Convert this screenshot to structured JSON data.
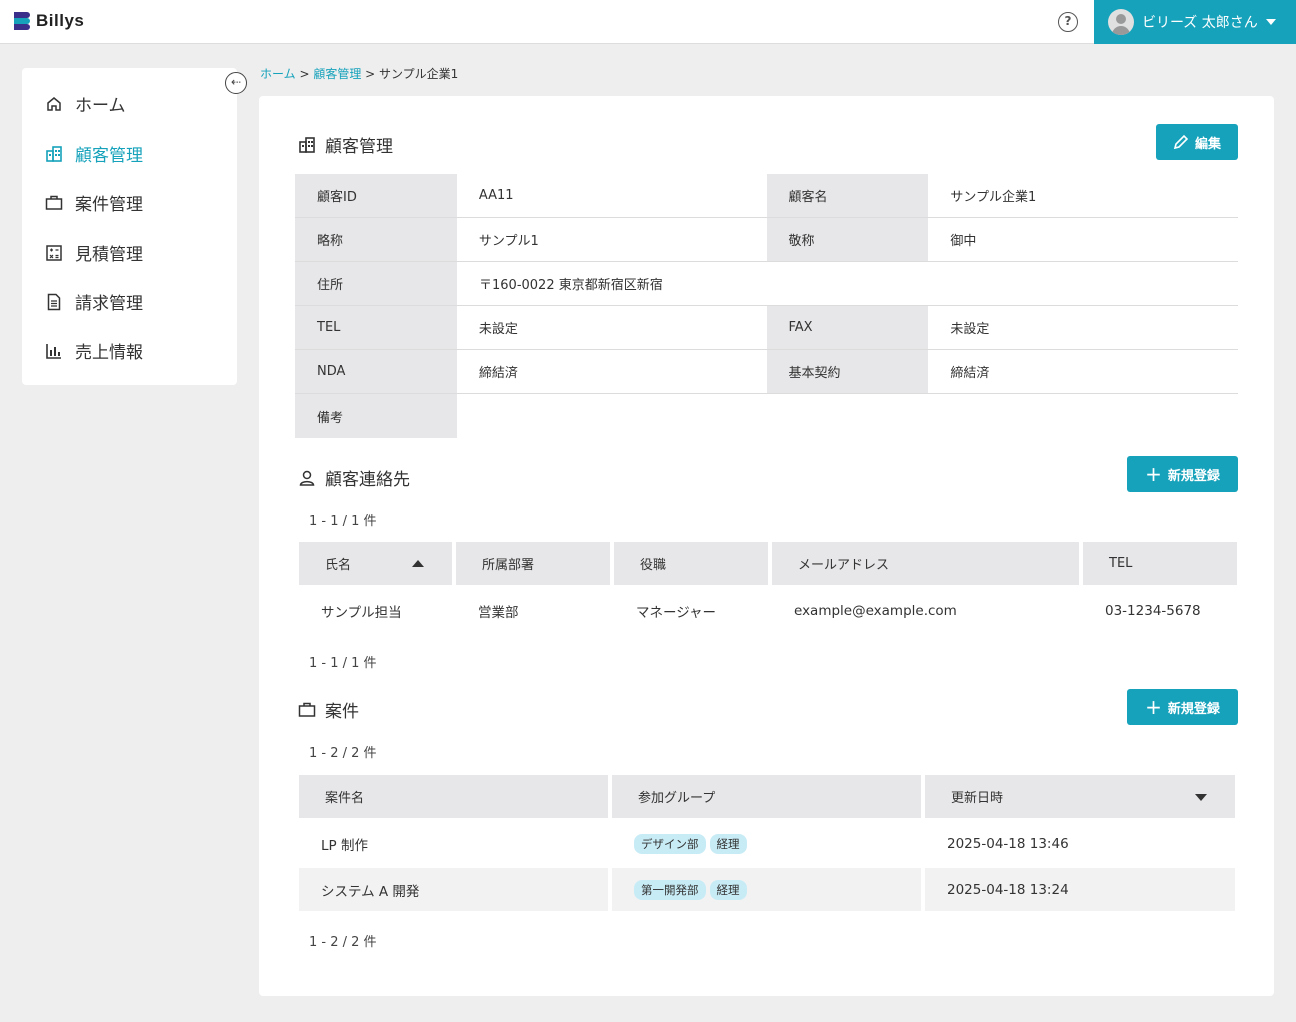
{
  "header": {
    "logo_text": "Billys",
    "help_icon": "?",
    "user_name": "ビリーズ 太郎さん"
  },
  "sidebar": {
    "items": [
      {
        "label": "ホーム",
        "icon": "home-icon"
      },
      {
        "label": "顧客管理",
        "icon": "building-icon",
        "active": true
      },
      {
        "label": "案件管理",
        "icon": "briefcase-icon"
      },
      {
        "label": "見積管理",
        "icon": "calculator-icon"
      },
      {
        "label": "請求管理",
        "icon": "document-icon"
      },
      {
        "label": "売上情報",
        "icon": "bar-chart-icon"
      }
    ]
  },
  "breadcrumb": {
    "home": "ホーム",
    "sep1": " > ",
    "customers": "顧客管理",
    "sep2": " > ",
    "current": "サンプル企業1"
  },
  "customer": {
    "title": "顧客管理",
    "edit_label": "編集",
    "fields": {
      "id_label": "顧客ID",
      "id_value": "AA11",
      "name_label": "顧客名",
      "name_value": "サンプル企業1",
      "short_label": "略称",
      "short_value": "サンプル1",
      "honorific_label": "敬称",
      "honorific_value": "御中",
      "address_label": "住所",
      "address_value": "〒160-0022 東京都新宿区新宿",
      "tel_label": "TEL",
      "tel_value": "未設定",
      "fax_label": "FAX",
      "fax_value": "未設定",
      "nda_label": "NDA",
      "nda_value": "締結済",
      "contract_label": "基本契約",
      "contract_value": "締結済",
      "notes_label": "備考",
      "notes_value": ""
    }
  },
  "contacts": {
    "title": "顧客連絡先",
    "new_label": "新規登録",
    "count_top": "1 - 1 / 1 件",
    "count_bottom": "1 - 1 / 1 件",
    "columns": [
      "氏名",
      "所属部署",
      "役職",
      "メールアドレス",
      "TEL"
    ],
    "rows": [
      {
        "name": "サンプル担当",
        "dept": "営業部",
        "role": "マネージャー",
        "email": "example@example.com",
        "tel": "03-1234-5678"
      }
    ]
  },
  "projects": {
    "title": "案件",
    "new_label": "新規登録",
    "count_top": "1 - 2 / 2 件",
    "count_bottom": "1 - 2 / 2 件",
    "columns": [
      "案件名",
      "参加グループ",
      "更新日時"
    ],
    "rows": [
      {
        "name": "LP 制作",
        "groups": [
          "デザイン部",
          "経理"
        ],
        "updated": "2025-04-18 13:46"
      },
      {
        "name": "システム A 開発",
        "groups": [
          "第一開発部",
          "経理"
        ],
        "updated": "2025-04-18 13:24"
      }
    ]
  },
  "colors": {
    "accent": "#16a2bb",
    "header_cell": "#e7e7e9",
    "tag_bg": "#c8ecf6"
  }
}
